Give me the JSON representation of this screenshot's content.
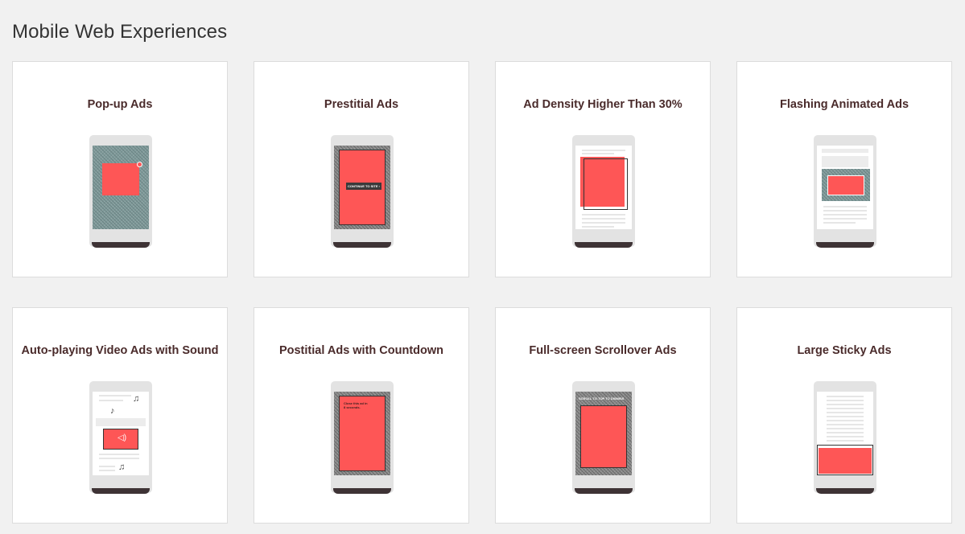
{
  "page": {
    "title": "Mobile Web Experiences"
  },
  "cards": [
    {
      "title": "Pop-up Ads"
    },
    {
      "title": "Prestitial Ads",
      "screen_text": "CONTINUE TO SITE ›"
    },
    {
      "title": "Ad Density Higher Than 30%"
    },
    {
      "title": "Flashing Animated Ads"
    },
    {
      "title": "Auto-playing Video Ads with Sound"
    },
    {
      "title": "Postitial Ads with Countdown",
      "screen_text": "Close this ad in 8 seconds."
    },
    {
      "title": "Full-screen Scrollover Ads",
      "screen_text": "SCROLL TO TOP TO DISMISS"
    },
    {
      "title": "Large Sticky Ads"
    }
  ],
  "colors": {
    "ad_red": "#fe5656",
    "phone_base": "#3e3335",
    "title_text": "#4a2b2b"
  },
  "icons": [
    "close-icon",
    "music-note-icon",
    "speaker-icon"
  ]
}
